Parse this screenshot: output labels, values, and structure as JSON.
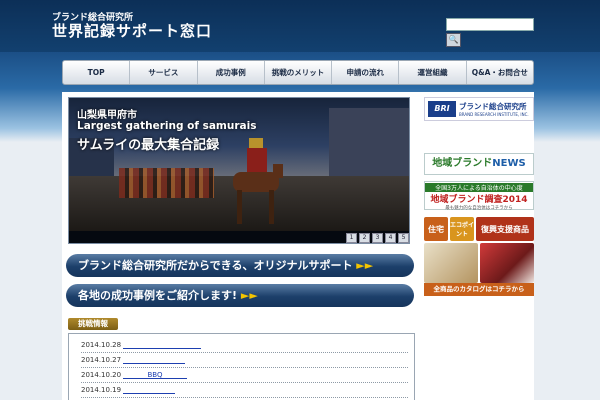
{
  "header": {
    "subtitle": "ブランド総合研究所",
    "title": "世界記録サポート窓口",
    "search_value": "",
    "search_button": "🔍"
  },
  "nav": [
    "TOP",
    "サービス",
    "成功事例",
    "挑戦のメリット",
    "申請の流れ",
    "運営組織",
    "Q&A・お問合せ"
  ],
  "hero": {
    "location": "山梨県甲府市",
    "headline_en": "Largest gathering of samurais",
    "headline_jp": "サムライの最大集合記録",
    "pages": [
      "1",
      "2",
      "3",
      "4",
      "5"
    ]
  },
  "banners": {
    "support": "ブランド総合研究所だからできる、オリジナルサポート",
    "support_arrow": "►►",
    "cases": "各地の成功事例をご紹介します!",
    "cases_arrow": "►►"
  },
  "news": {
    "tag": "挑戦情報",
    "items": [
      {
        "date": "2014.10.28",
        "text": "                   "
      },
      {
        "date": "2014.10.27",
        "text": "                "
      },
      {
        "date": "2014.10.20",
        "text": "BBQ"
      },
      {
        "date": "2014.10.19",
        "text": "          "
      }
    ]
  },
  "sidebar": {
    "bri_logo": "BRI",
    "bri_name": "ブランド総合研究所",
    "bri_en": "BRAND RESEARCH INSTITUTE, INC.",
    "regional_brand_1": "地域ブランド",
    "regional_brand_2": "NEWS",
    "survey_top": "全国3万人による自治体の中心度",
    "survey_main": "地域ブランド調査2014",
    "survey_sub": "最も魅力的な自治体はコチラから",
    "eco_1": "住宅",
    "eco_2": "エコポイント",
    "eco_3": "復興支援商品",
    "catalog": "全商品のカタログはコチラから"
  }
}
